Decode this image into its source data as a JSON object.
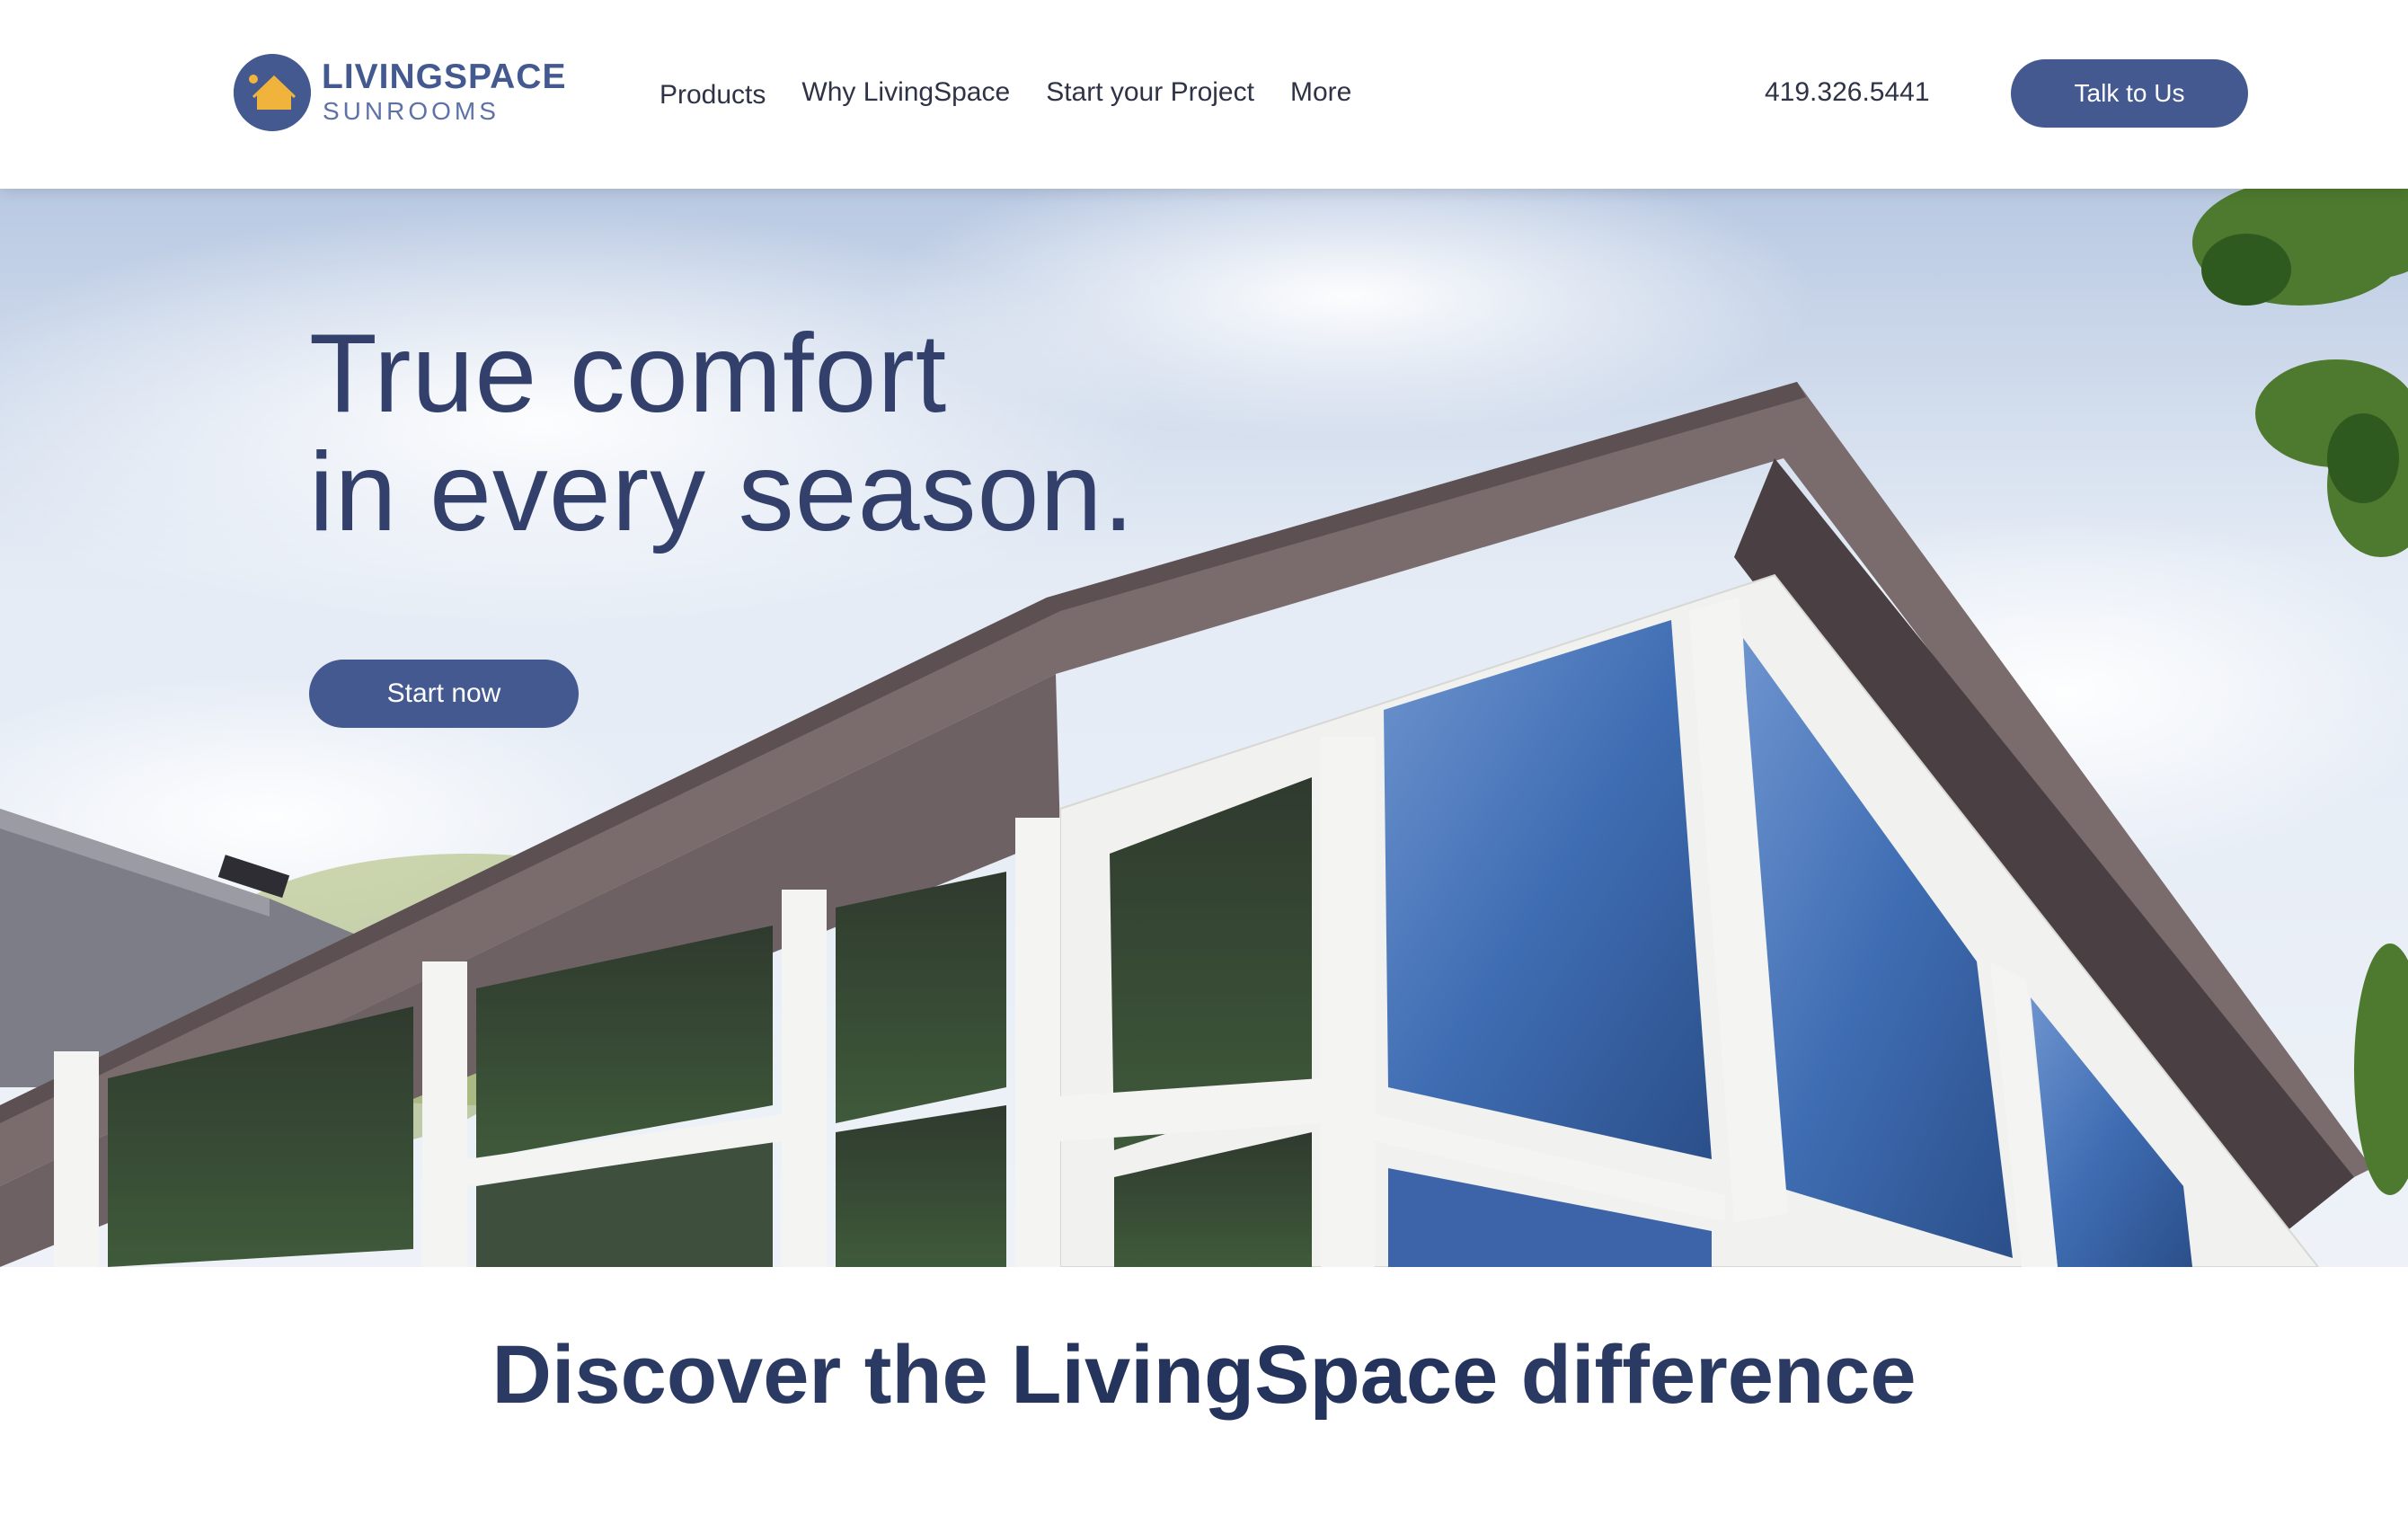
{
  "colors": {
    "brand": "#44598f",
    "heading": "#32406b",
    "text": "#2e3445",
    "logo_sun": "#f0b43c"
  },
  "header": {
    "logo": {
      "line1": "LIVINGSPACE",
      "line2": "SUNROOMS",
      "icon": "house-sun-icon"
    },
    "nav": [
      "Products",
      "Why LivingSpace",
      "Start your Project",
      "More"
    ],
    "phone": "419.326.5441",
    "cta_label": "Talk to Us"
  },
  "hero": {
    "title_line1": "True comfort",
    "title_line2": "in every season.",
    "cta_label": "Start now"
  },
  "discover": {
    "prefix": "Discover the ",
    "brand": "LivingSpace",
    "suffix": " difference"
  }
}
